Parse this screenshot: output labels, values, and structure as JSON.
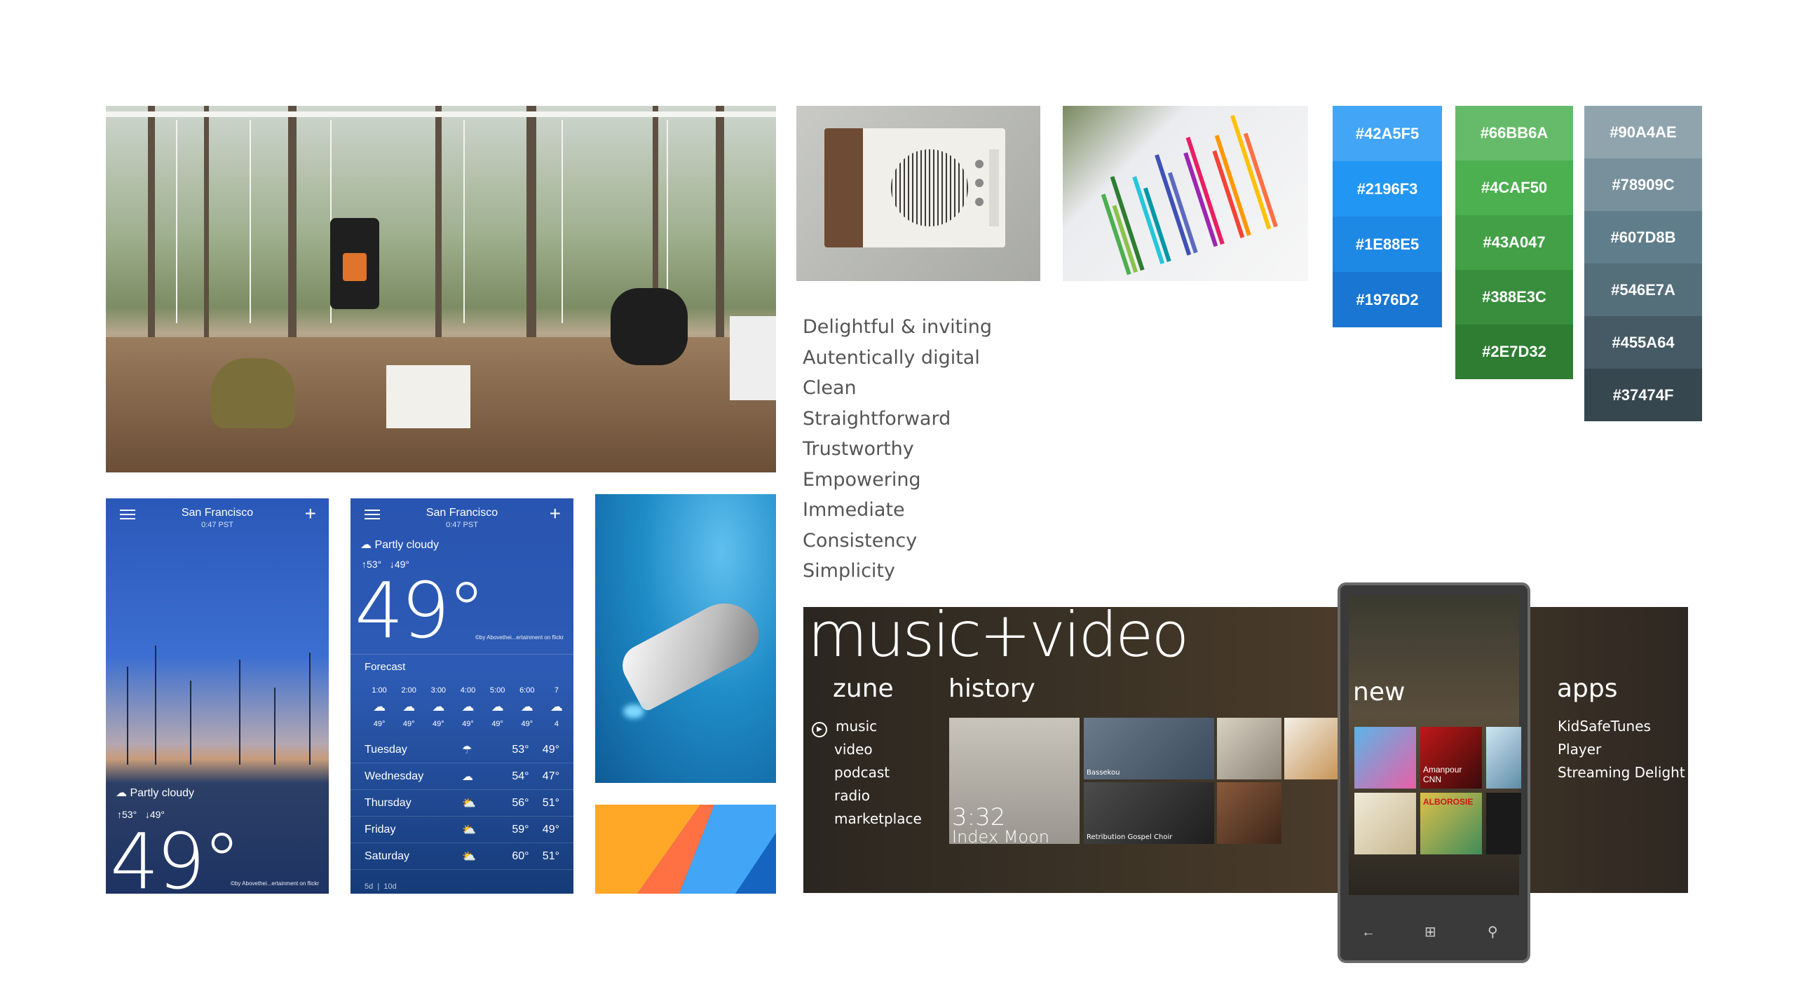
{
  "principles": [
    "Delightful & inviting",
    "Autentically digital",
    "Clean",
    "Straightforward",
    "Trustworthy",
    "Empowering",
    "Immediate",
    "Consistency",
    "Simplicity"
  ],
  "palettes": {
    "blue": [
      {
        "hex": "#42A5F5",
        "color": "#42A5F5"
      },
      {
        "hex": "#2196F3",
        "color": "#2196F3"
      },
      {
        "hex": "#1E88E5",
        "color": "#1E88E5"
      },
      {
        "hex": "#1976D2",
        "color": "#1976D2"
      }
    ],
    "green": [
      {
        "hex": "#66BB6A",
        "color": "#66BB6A"
      },
      {
        "hex": "#4CAF50",
        "color": "#4CAF50"
      },
      {
        "hex": "#43A047",
        "color": "#43A047"
      },
      {
        "hex": "#388E3C",
        "color": "#388E3C"
      },
      {
        "hex": "#2E7D32",
        "color": "#2E7D32"
      }
    ],
    "grey": [
      {
        "hex": "#90A4AE",
        "color": "#90A4AE"
      },
      {
        "hex": "#78909C",
        "color": "#78909C"
      },
      {
        "hex": "#607D8B",
        "color": "#607D8B"
      },
      {
        "hex": "#546E7A",
        "color": "#546E7A"
      },
      {
        "hex": "#455A64",
        "color": "#455A64"
      },
      {
        "hex": "#37474F",
        "color": "#37474F"
      }
    ]
  },
  "weather1": {
    "city": "San Francisco",
    "time": "0:47 PST",
    "condition": "Partly cloudy",
    "hi": "53°",
    "lo": "49°",
    "temp": "49°",
    "credit": "©by Abovethei...ertainment on flickr"
  },
  "weather2": {
    "city": "San Francisco",
    "time": "0:47 PST",
    "condition": "Partly cloudy",
    "hi": "53°",
    "lo": "49°",
    "temp": "49°",
    "credit": "©by Abovethei...ertainment on flickr",
    "forecast_label": "Forecast",
    "hours": [
      "1:00",
      "2:00",
      "3:00",
      "4:00",
      "5:00",
      "6:00",
      "7"
    ],
    "hour_temps": [
      "49°",
      "49°",
      "49°",
      "49°",
      "49°",
      "49°",
      "4"
    ],
    "days": [
      {
        "name": "Tuesday",
        "hi": "53°",
        "lo": "49°"
      },
      {
        "name": "Wednesday",
        "hi": "54°",
        "lo": "47°"
      },
      {
        "name": "Thursday",
        "hi": "56°",
        "lo": "51°"
      },
      {
        "name": "Friday",
        "hi": "59°",
        "lo": "49°"
      },
      {
        "name": "Saturday",
        "hi": "60°",
        "lo": "51°"
      }
    ],
    "tabs": [
      "5d",
      "10d"
    ]
  },
  "zune": {
    "title": "music+video",
    "zune_label": "zune",
    "history_label": "history",
    "new_label": "new",
    "apps_label": "apps",
    "menu": [
      "music",
      "video",
      "podcast",
      "radio",
      "marketplace"
    ],
    "apps": [
      "KidSafeTunes",
      "Player",
      "Streaming Delight"
    ],
    "now_time": "3:32",
    "now_title": "Index Moon",
    "tile_captions": [
      "Bassekou",
      "Retribution Gospel Choir",
      "Amanpour CNN",
      "ALBOROSIE"
    ]
  }
}
